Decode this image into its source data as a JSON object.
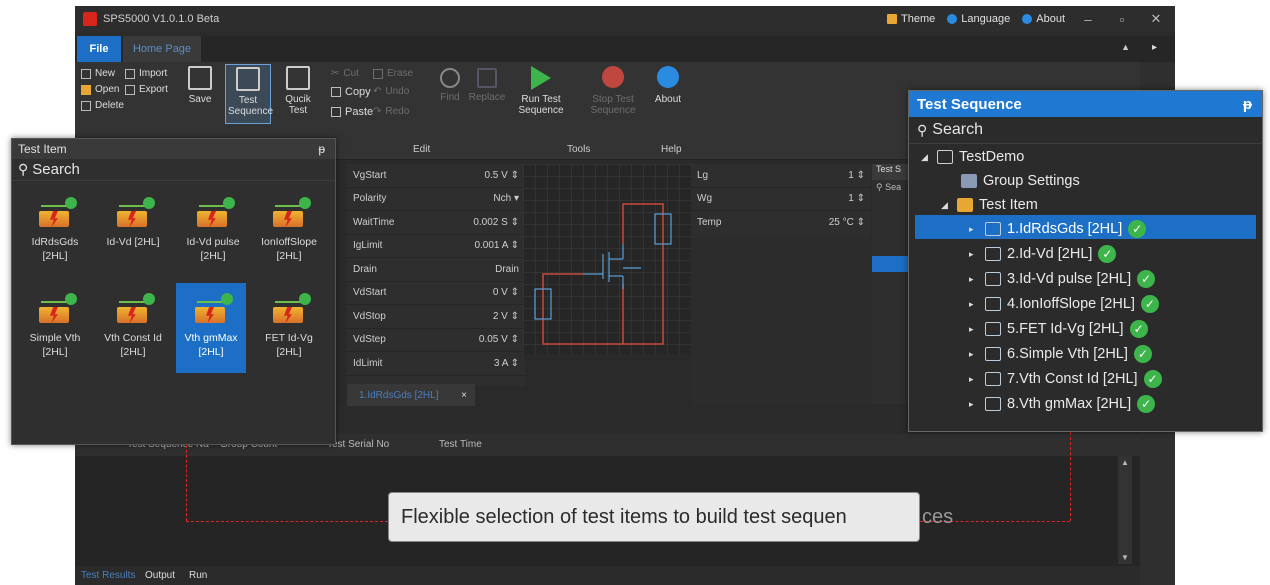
{
  "window": {
    "title": "SPS5000 V1.0.1.0 Beta",
    "theme_label": "Theme",
    "language_label": "Language",
    "about_label": "About",
    "colors": {
      "accent": "#1c6fc4",
      "check": "#3db54a",
      "brand": "#d9261c",
      "dash": "#e02424"
    }
  },
  "tabs": {
    "file": "File",
    "home": "Home Page"
  },
  "ribbon": {
    "new": "New",
    "open": "Open",
    "delete": "Delete",
    "import": "Import",
    "export": "Export",
    "save": "Save",
    "test_sequence": "Test Sequence",
    "quick_test": "Qucik Test",
    "cut": "Cut",
    "copy": "Copy",
    "paste": "Paste",
    "erase": "Erase",
    "undo": "Undo",
    "redo": "Redo",
    "find": "Find",
    "replace": "Replace",
    "run_test_sequence": "Run Test Sequence",
    "stop_test_sequence": "Stop Test Sequence",
    "about": "About",
    "group_edit": "Edit",
    "group_tools": "Tools",
    "group_help": "Help"
  },
  "properties": [
    {
      "name": "VgStart",
      "value": "0.5 V"
    },
    {
      "name": "Polarity",
      "value": "Nch"
    },
    {
      "name": "WaitTime",
      "value": "0.002 S"
    },
    {
      "name": "IgLimit",
      "value": "0.001 A"
    },
    {
      "name": "Drain",
      "value": "Drain"
    },
    {
      "name": "VdStart",
      "value": "0 V"
    },
    {
      "name": "VdStop",
      "value": "2 V"
    },
    {
      "name": "VdStep",
      "value": "0.05 V"
    },
    {
      "name": "IdLimit",
      "value": "3 A"
    }
  ],
  "properties2": [
    {
      "name": "Lg",
      "value": "1"
    },
    {
      "name": "Wg",
      "value": "1"
    },
    {
      "name": "Temp",
      "value": "25 °C"
    }
  ],
  "doc_tab": {
    "label": "1.IdRdsGds [2HL]",
    "close": "×"
  },
  "narrow_panel": {
    "header": "Test S",
    "search": "Sea"
  },
  "bottom": {
    "columns": [
      "Test Sequence Na",
      "Group Count",
      "Test Serial No",
      "Test Time"
    ],
    "tabs": [
      "Test Results",
      "Output",
      "Run"
    ]
  },
  "caption": {
    "text": "Flexible selection of test items to build test sequen",
    "tail": "ces"
  },
  "test_item_panel": {
    "title": "Test Item",
    "pin": "ᵽ",
    "search": "Search",
    "items": [
      {
        "label": "IdRdsGds [2HL]"
      },
      {
        "label": "Id-Vd [2HL]"
      },
      {
        "label": "Id-Vd pulse [2HL]"
      },
      {
        "label": "IonIoffSlope [2HL]"
      },
      {
        "label": "Simple Vth [2HL]"
      },
      {
        "label": "Vth Const Id [2HL]"
      },
      {
        "label": "Vth gmMax [2HL]"
      },
      {
        "label": "FET Id-Vg [2HL]"
      }
    ]
  },
  "test_sequence_panel": {
    "title": "Test Sequence",
    "pin": "ᵽ",
    "search": "Search",
    "root": "TestDemo",
    "group_settings": "Group Settings",
    "folder": "Test Item",
    "items": [
      "1.IdRdsGds [2HL]",
      "2.Id-Vd [2HL]",
      "3.Id-Vd pulse [2HL]",
      "4.IonIoffSlope [2HL]",
      "5.FET Id-Vg [2HL]",
      "6.Simple Vth [2HL]",
      "7.Vth Const Id [2HL]",
      "8.Vth gmMax [2HL]"
    ]
  }
}
